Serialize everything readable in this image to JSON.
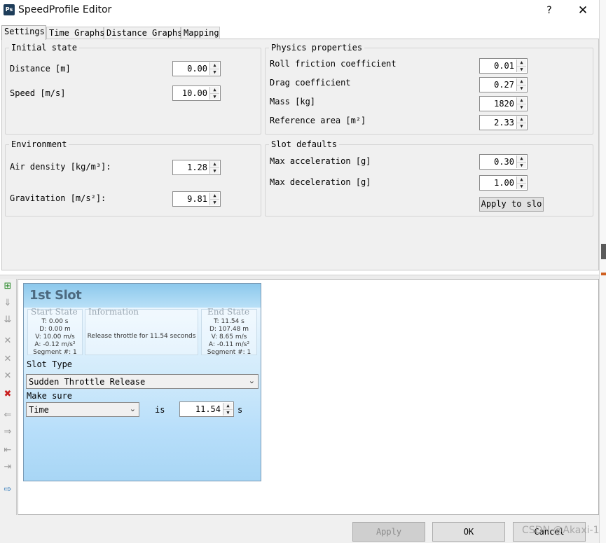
{
  "window": {
    "title": "SpeedProfile Editor",
    "icon_text": "Ps",
    "help_label": "?",
    "close_label": "✕"
  },
  "tabs": [
    {
      "label": "Settings",
      "active": true
    },
    {
      "label": "Time Graphs",
      "active": false
    },
    {
      "label": "Distance Graphs",
      "active": false
    },
    {
      "label": "Mapping",
      "active": false
    }
  ],
  "settings": {
    "initial_state": {
      "title": "Initial state",
      "distance_label": "Distance [m]",
      "distance_value": "0.00",
      "speed_label": "Speed [m/s]",
      "speed_value": "10.00"
    },
    "environment": {
      "title": "Environment",
      "air_density_label": "Air density [kg/m³]:",
      "air_density_value": "1.28",
      "gravitation_label": "Gravitation [m/s²]:",
      "gravitation_value": "9.81"
    },
    "physics": {
      "title": "Physics properties",
      "roll_label": "Roll friction coefficient",
      "roll_value": "0.01",
      "drag_label": "Drag coefficient",
      "drag_value": "0.27",
      "mass_label": "Mass [kg]",
      "mass_value": "1820",
      "area_label": "Reference area [m²]",
      "area_value": "2.33"
    },
    "slot_defaults": {
      "title": "Slot defaults",
      "max_acc_label": "Max acceleration [g]",
      "max_acc_value": "0.30",
      "max_dec_label": "Max deceleration [g]",
      "max_dec_value": "1.00",
      "apply_label": "Apply to slo"
    }
  },
  "toolbar_icons": [
    "add-slot-icon",
    "insert-slot-icon",
    "insert-after-icon",
    "delete-slot-icon",
    "delete-next-icon",
    "delete-prev-icon",
    "delete-all-icon",
    "move-left-icon",
    "move-right-icon",
    "move-first-icon",
    "move-last-icon",
    "export-icon"
  ],
  "slot": {
    "title": "1st Slot",
    "start_head": "Start State",
    "start_lines": [
      "T: 0.00 s",
      "D: 0.00 m",
      "V: 10.00 m/s",
      "A: -0.12 m/s²",
      "Segment #: 1"
    ],
    "info_head": "Information",
    "info_text": "Release throttle for 11.54 seconds",
    "end_head": "End State",
    "end_lines": [
      "T: 11.54 s",
      "D: 107.48 m",
      "V: 8.65 m/s",
      "A: -0.11 m/s²",
      "Segment #: 1"
    ],
    "slot_type_label": "Slot Type",
    "slot_type_value": "Sudden Throttle Release",
    "make_sure_label": "Make sure",
    "condition_value": "Time",
    "is_label": "is",
    "target_value": "11.54",
    "unit_label": "s"
  },
  "buttons": {
    "apply": "Apply",
    "ok": "OK",
    "cancel": "Cancel"
  },
  "watermark": "CSDN @Akaxi-1",
  "colors": {
    "accent": "#1e3d5a",
    "slot_gradient_top": "#f4faff",
    "slot_gradient_bottom": "#a8d6f5"
  }
}
